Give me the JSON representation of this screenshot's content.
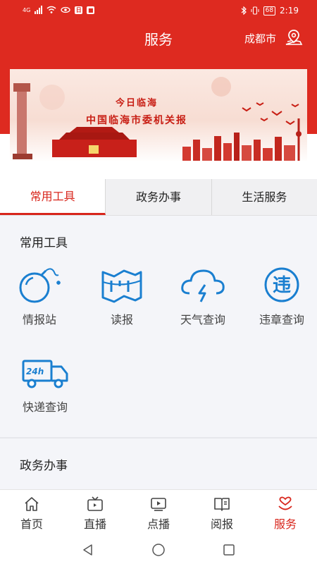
{
  "status": {
    "network": "4G",
    "battery": "68",
    "time": "2:19"
  },
  "header": {
    "title": "服务",
    "city": "成都市"
  },
  "banner": {
    "line1": "今日临海",
    "line2": "中国临海市委机关报"
  },
  "tabs": [
    "常用工具",
    "政务办事",
    "生活服务"
  ],
  "sections": {
    "tools_title": "常用工具",
    "tools": [
      {
        "label": "情报站",
        "icon": "bomb-icon"
      },
      {
        "label": "读报",
        "icon": "newspaper-map-icon"
      },
      {
        "label": "天气查询",
        "icon": "weather-cloud-icon"
      },
      {
        "label": "违章查询",
        "icon": "violation-icon"
      },
      {
        "label": "快递查询",
        "icon": "delivery-truck-icon"
      }
    ],
    "gov_title": "政务办事"
  },
  "nav": [
    {
      "label": "首页",
      "icon": "home-icon"
    },
    {
      "label": "直播",
      "icon": "tv-icon"
    },
    {
      "label": "点播",
      "icon": "video-play-icon"
    },
    {
      "label": "阅报",
      "icon": "book-icon"
    },
    {
      "label": "服务",
      "icon": "heart-service-icon"
    }
  ],
  "colors": {
    "brand_red": "#de2a20",
    "icon_blue": "#1a7fd0",
    "active_red": "#d8261c"
  }
}
